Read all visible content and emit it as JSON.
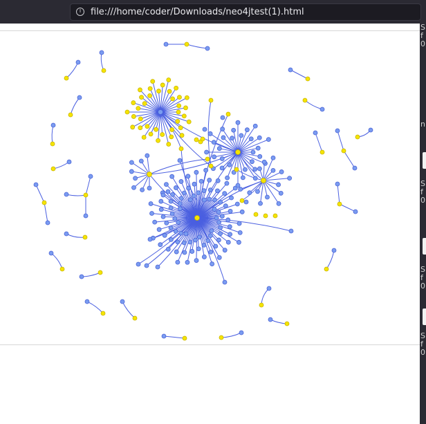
{
  "browser": {
    "url": "file:///home/coder/Downloads/neo4jtest(1).html",
    "info_icon": "info-icon"
  },
  "side_panel": {
    "glyphs": [
      "S",
      "f",
      "0",
      "n",
      "S",
      "f",
      "0",
      "S",
      "f",
      "0",
      "S",
      "f",
      "0"
    ]
  },
  "graph": {
    "colors": {
      "edge": "#4a5fe0",
      "node_blue": "#7a9cf0",
      "node_blue_stroke": "#4a62d6",
      "node_yellow": "#f5e400",
      "node_yellow_stroke": "#c8b400"
    }
  }
}
